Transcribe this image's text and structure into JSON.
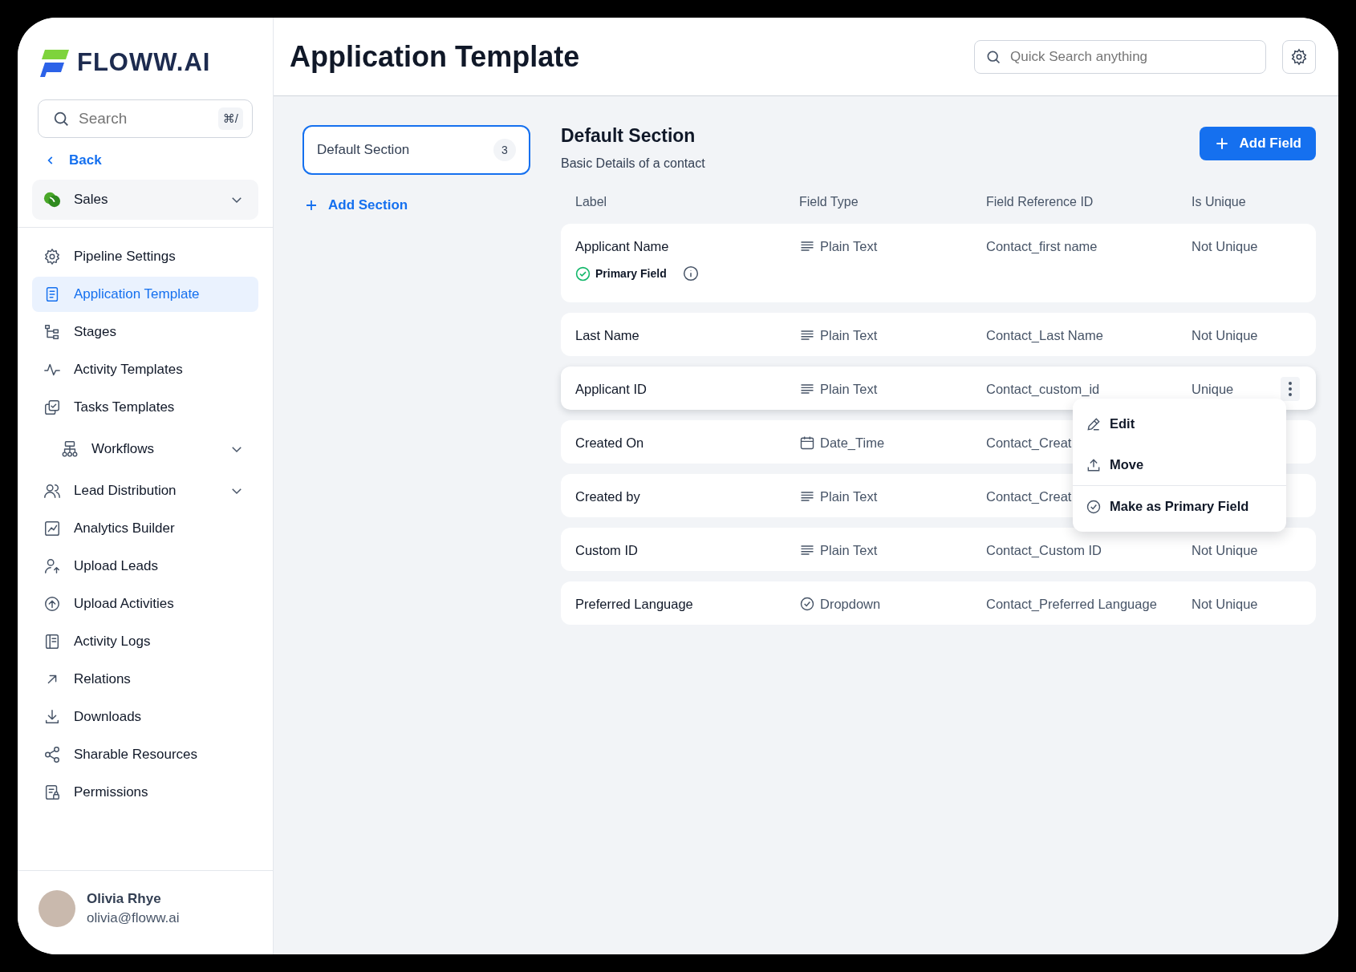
{
  "sidebar": {
    "logo": "FLOWW.AI",
    "search": {
      "placeholder": "Search",
      "shortcut": "⌘/"
    },
    "back": "Back",
    "workspace": {
      "name": "Sales",
      "expanded": false
    },
    "items": [
      {
        "label": "Pipeline Settings",
        "selected": false
      },
      {
        "label": "Application Template",
        "selected": true
      },
      {
        "label": "Stages",
        "selected": false
      },
      {
        "label": "Activity Templates",
        "selected": false
      },
      {
        "label": "Tasks Templates",
        "selected": false
      },
      {
        "label": "Workflows",
        "selected": false,
        "expandable": true,
        "indented": true
      },
      {
        "label": "Lead Distribution",
        "selected": false,
        "expandable": true
      },
      {
        "label": "Analytics Builder",
        "selected": false
      },
      {
        "label": "Upload Leads",
        "selected": false
      },
      {
        "label": "Upload Activities",
        "selected": false
      },
      {
        "label": "Activity Logs",
        "selected": false
      },
      {
        "label": "Relations",
        "selected": false
      },
      {
        "label": "Downloads",
        "selected": false
      },
      {
        "label": "Sharable Resources",
        "selected": false
      },
      {
        "label": "Permissions",
        "selected": false
      }
    ],
    "user": {
      "name": "Olivia Rhye",
      "email": "olivia@floww.ai"
    }
  },
  "header": {
    "title": "Application Template",
    "search": {
      "placeholder": "Quick Search anything"
    }
  },
  "sections": [
    {
      "name": "Default Section",
      "count": "3",
      "selected": true
    }
  ],
  "add_section": "Add Section",
  "section": {
    "title": "Default Section",
    "subtitle": "Basic Details of a contact",
    "add_field": "Add Field"
  },
  "table": {
    "columns": [
      "Label",
      "Field Type",
      "Field Reference ID",
      "Is Unique"
    ],
    "rows": [
      {
        "label": "Applicant Name",
        "type": "Plain Text",
        "kind": "text",
        "ref": "Contact_first name",
        "unique": "Not Unique",
        "primary": "Primary Field",
        "hovered": false
      },
      {
        "label": "Last Name",
        "type": "Plain Text",
        "kind": "text",
        "ref": "Contact_Last Name",
        "unique": "Not Unique",
        "hovered": false
      },
      {
        "label": "Applicant ID",
        "type": "Plain Text",
        "kind": "text",
        "ref": "Contact_custom_id",
        "unique": "Unique",
        "hovered": true
      },
      {
        "label": "Created On",
        "type": "Date_Time",
        "kind": "date",
        "ref": "Contact_Creat",
        "hovered": false
      },
      {
        "label": "Created by",
        "type": "Plain Text",
        "kind": "text",
        "ref": "Contact_Creat",
        "hovered": false
      },
      {
        "label": "Custom ID",
        "type": "Plain  Text",
        "kind": "text",
        "ref": "Contact_Custom ID",
        "unique": "Not Unique",
        "hovered": false
      },
      {
        "label": "Preferred Language",
        "type": "Dropdown",
        "kind": "dropdown",
        "ref": "Contact_Preferred Language",
        "unique": "Not Unique",
        "hovered": false
      }
    ]
  },
  "menu": {
    "items": [
      {
        "label": "Edit",
        "divider": false
      },
      {
        "label": "Move",
        "divider": false
      },
      {
        "label": "Make as Primary Field",
        "divider": true
      }
    ]
  }
}
